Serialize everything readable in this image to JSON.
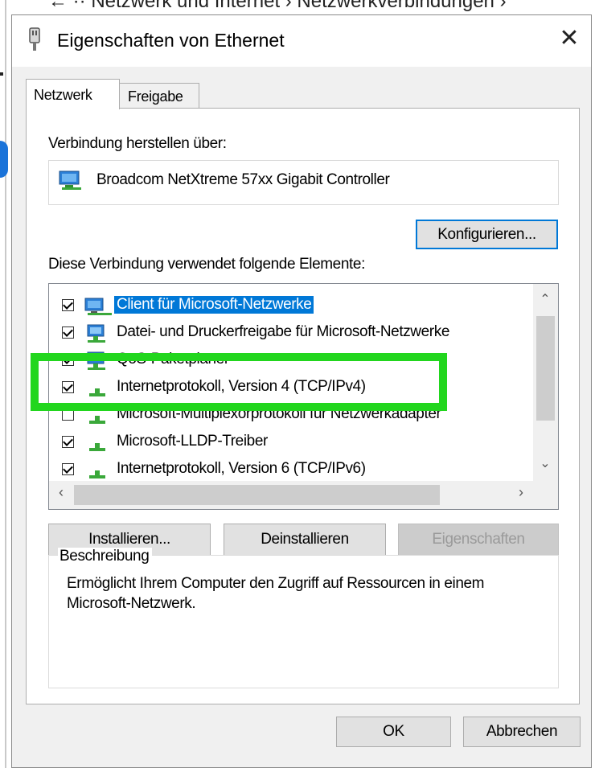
{
  "background": {
    "breadcrumb": "← ··  Netzwerk und Internet  ›  Netzwerkverbindungen  ›"
  },
  "dialog": {
    "title": "Eigenschaften von Ethernet",
    "close_label": "✕"
  },
  "tabs": [
    {
      "label": "Netzwerk",
      "active": true
    },
    {
      "label": "Freigabe",
      "active": false
    }
  ],
  "connect_via_label": "Verbindung herstellen über:",
  "adapter_name": "Broadcom NetXtreme 57xx Gigabit Controller",
  "configure_button": "Konfigurieren...",
  "elements_label": "Diese Verbindung verwendet folgende Elemente:",
  "items": [
    {
      "label": "Client für Microsoft-Netzwerke",
      "checked": true,
      "selected": true,
      "icon": "network-client-icon"
    },
    {
      "label": "Datei- und Druckerfreigabe für Microsoft-Netzwerke",
      "checked": true,
      "selected": false,
      "icon": "network-service-icon"
    },
    {
      "label": "QoS-Paketplaner",
      "checked": true,
      "selected": false,
      "icon": "network-service-icon"
    },
    {
      "label": "Internetprotokoll, Version 4 (TCP/IPv4)",
      "checked": true,
      "selected": false,
      "icon": "protocol-icon"
    },
    {
      "label": "Microsoft-Multiplexorprotokoll für Netzwerkadapter",
      "checked": false,
      "selected": false,
      "icon": "protocol-icon"
    },
    {
      "label": "Microsoft-LLDP-Treiber",
      "checked": true,
      "selected": false,
      "icon": "protocol-icon"
    },
    {
      "label": "Internetprotokoll, Version 6 (TCP/IPv6)",
      "checked": true,
      "selected": false,
      "icon": "protocol-icon"
    }
  ],
  "buttons": {
    "install": "Installieren...",
    "uninstall": "Deinstallieren",
    "properties": "Eigenschaften",
    "ok": "OK",
    "cancel": "Abbrechen"
  },
  "description": {
    "legend": "Beschreibung",
    "text": "Ermöglicht Ihrem Computer den Zugriff auf Ressourcen in einem Microsoft-Netzwerk."
  },
  "colors": {
    "selection": "#0078d7",
    "highlight_annotation": "#22d61e"
  }
}
